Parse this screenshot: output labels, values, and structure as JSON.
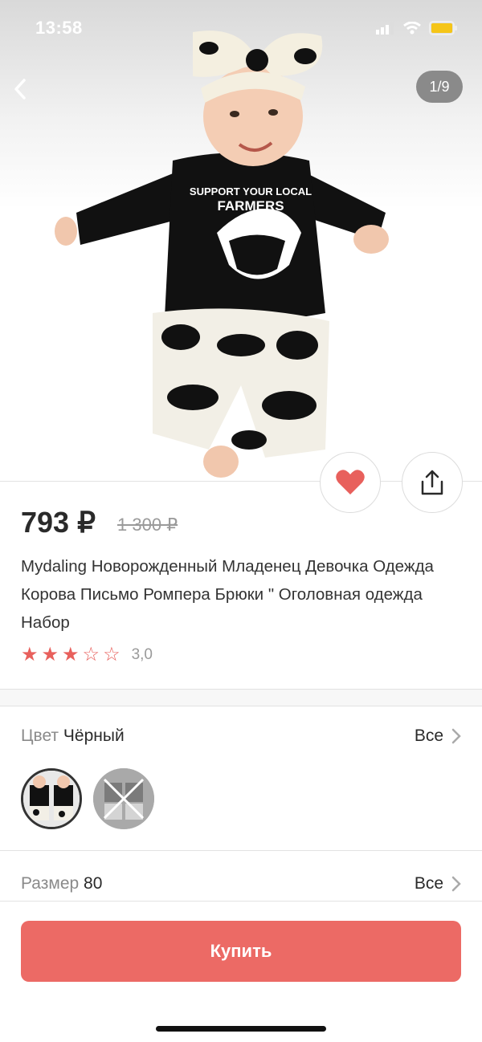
{
  "status_bar": {
    "time": "13:58"
  },
  "gallery": {
    "counter": "1/9"
  },
  "product": {
    "price": "793 ₽",
    "old_price": "1 300 ₽",
    "title": "Mydaling Новорожденный Младенец Девочка Одежда Корова Письмо Ромпера Брюки \" Оголовная одежда Набор",
    "rating": "3,0",
    "rating_stars": 3,
    "shirt_text_top": "SUPPORT YOUR LOCAL",
    "shirt_text_main": "FARMERS"
  },
  "options": {
    "color_label": "Цвет",
    "color_value": "Чёрный",
    "size_label": "Размер",
    "size_value": "80",
    "all_label": "Все"
  },
  "actions": {
    "buy_label": "Купить"
  },
  "colors": {
    "accent": "#ec6a65",
    "heart": "#e8605c"
  }
}
